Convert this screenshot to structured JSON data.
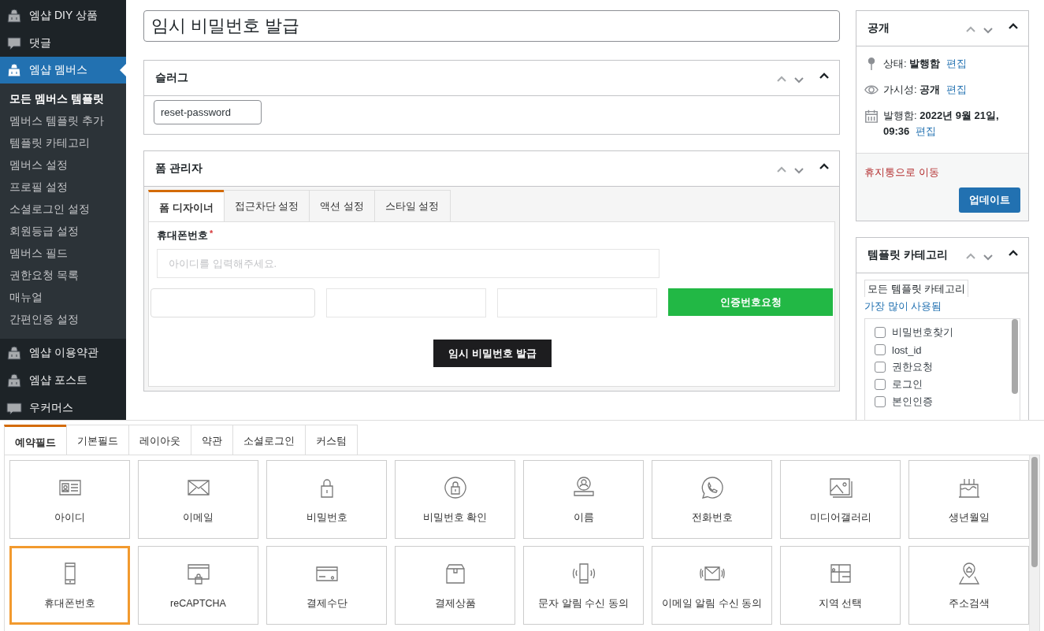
{
  "sidebar": {
    "items": [
      {
        "label": "엠샵 DIY 상품",
        "kind": "bag",
        "selected": false
      },
      {
        "label": "댓글",
        "kind": "comment",
        "selected": false
      },
      {
        "label": "엠샵 멤버스",
        "kind": "bag",
        "selected": true,
        "children": [
          {
            "label": "모든 멤버스 템플릿",
            "selected": true
          },
          {
            "label": "멤버스 템플릿 추가",
            "selected": false
          },
          {
            "label": "템플릿 카테고리",
            "selected": false
          },
          {
            "label": "멤버스 설정",
            "selected": false
          },
          {
            "label": "프로필 설정",
            "selected": false
          },
          {
            "label": "소셜로그인 설정",
            "selected": false
          },
          {
            "label": "회원등급 설정",
            "selected": false
          },
          {
            "label": "멤버스 필드",
            "selected": false
          },
          {
            "label": "권한요청 목록",
            "selected": false
          },
          {
            "label": "매뉴얼",
            "selected": false
          },
          {
            "label": "간편인증 설정",
            "selected": false
          }
        ]
      },
      {
        "label": "엠샵 이용약관",
        "kind": "bag",
        "selected": false
      },
      {
        "label": "엠샵 포스트",
        "kind": "bag",
        "selected": false
      },
      {
        "label": "우커머스",
        "kind": "woo",
        "selected": false
      }
    ]
  },
  "title_field": {
    "value": "임시 비밀번호 발급"
  },
  "slug_box": {
    "title": "슬러그",
    "value": "reset-password"
  },
  "form_manager": {
    "title": "폼 관리자",
    "tabs": [
      {
        "label": "폼 디자이너",
        "selected": true
      },
      {
        "label": "접근차단 설정",
        "selected": false
      },
      {
        "label": "액션 설정",
        "selected": false
      },
      {
        "label": "스타일 설정",
        "selected": false
      }
    ],
    "preview": {
      "field_label": "휴대폰번호",
      "required_mark": "*",
      "placeholder": "아이디를 입력해주세요.",
      "verify_button": "인증번호요청",
      "submit_button": "임시 비밀번호 발급"
    }
  },
  "publish_box": {
    "title": "공개",
    "rows": [
      {
        "kind": "pin",
        "text": "상태: **발행함**",
        "link": "편집"
      },
      {
        "kind": "eye",
        "text": "가시성: **공개**",
        "link": "편집"
      },
      {
        "kind": "calendar",
        "text": "발행함: **2022년 9월 21일, 09:36**",
        "link": "편집"
      }
    ],
    "trash_link": "휴지통으로 이동",
    "update_button": "업데이트"
  },
  "category_box": {
    "title": "템플릿 카테고리",
    "tabs": [
      {
        "label": "모든 템플릿 카테고리",
        "selected": true
      },
      {
        "label": "가장 많이 사용됨",
        "selected": false
      }
    ],
    "items": [
      {
        "label": "비밀번호찾기",
        "checked": false
      },
      {
        "label": "lost_id",
        "checked": false
      },
      {
        "label": "권한요청",
        "checked": false
      },
      {
        "label": "로그인",
        "checked": false
      },
      {
        "label": "본인인증",
        "checked": false
      }
    ]
  },
  "field_panel": {
    "tabs": [
      {
        "label": "예약필드",
        "selected": true
      },
      {
        "label": "기본필드",
        "selected": false
      },
      {
        "label": "레이아웃",
        "selected": false
      },
      {
        "label": "약관",
        "selected": false
      },
      {
        "label": "소셜로그인",
        "selected": false
      },
      {
        "label": "커스텀",
        "selected": false
      }
    ],
    "tiles": [
      {
        "label": "아이디",
        "selected": false
      },
      {
        "label": "이메일",
        "selected": false
      },
      {
        "label": "비밀번호",
        "selected": false
      },
      {
        "label": "비밀번호 확인",
        "selected": false
      },
      {
        "label": "이름",
        "selected": false
      },
      {
        "label": "전화번호",
        "selected": false
      },
      {
        "label": "미디어갤러리",
        "selected": false
      },
      {
        "label": "생년월일",
        "selected": false
      },
      {
        "label": "휴대폰번호",
        "selected": true
      },
      {
        "label": "reCAPTCHA",
        "selected": false
      },
      {
        "label": "결제수단",
        "selected": false
      },
      {
        "label": "결제상품",
        "selected": false
      },
      {
        "label": "문자 알림 수신 동의",
        "selected": false
      },
      {
        "label": "이메일 알림 수신 동의",
        "selected": false
      },
      {
        "label": "지역 선택",
        "selected": false
      },
      {
        "label": "주소검색",
        "selected": false
      }
    ]
  }
}
